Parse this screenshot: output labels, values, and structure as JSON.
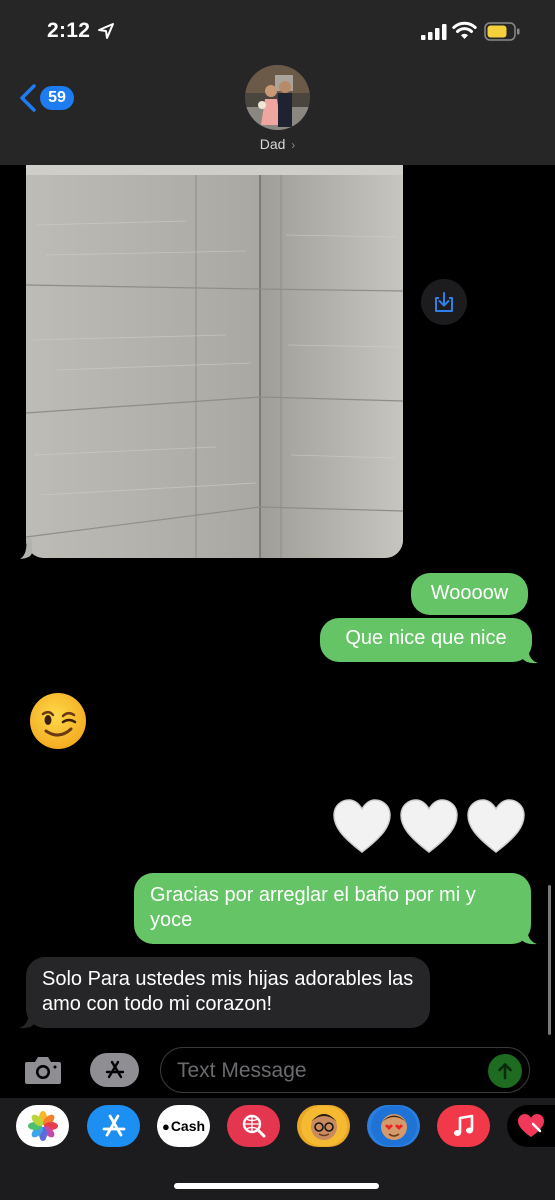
{
  "status_bar": {
    "time": "2:12"
  },
  "header": {
    "back_count": "59",
    "contact_name": "Dad",
    "contact_chevron": "›"
  },
  "messages": {
    "m1": "Woooow",
    "m2": "Que nice que nice",
    "m3": "Gracias por arreglar el baño por mi y yoce",
    "m4": "Solo Para ustedes mis hijas adorables las amo con todo mi corazon!"
  },
  "composer": {
    "placeholder": "Text Message"
  },
  "apps": {
    "cash_label": "Cash"
  },
  "colors": {
    "outgoing": "#65c466",
    "incoming": "#262628",
    "accent": "#1d7cf2"
  }
}
